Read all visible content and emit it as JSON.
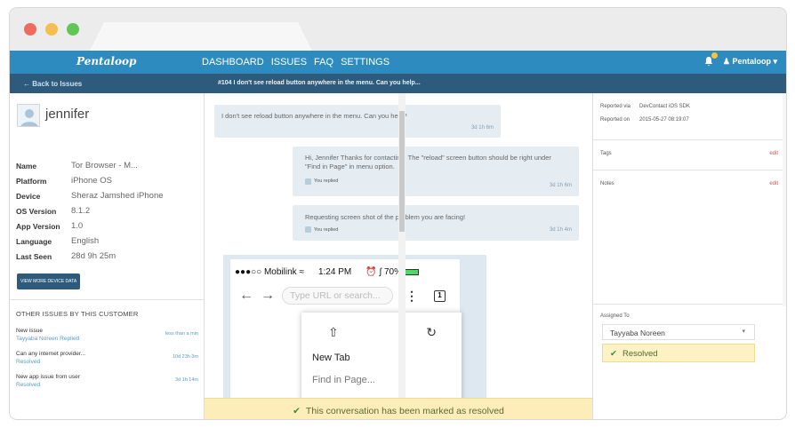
{
  "app": {
    "logo": "Pentaloop"
  },
  "nav": {
    "items": [
      "DASHBOARD",
      "ISSUES",
      "FAQ",
      "SETTINGS"
    ],
    "user": "Pentaloop"
  },
  "subbar": {
    "back": "← Back to Issues",
    "subject": "#104 I don't see reload button anywhere in the menu. Can you help..."
  },
  "customer": {
    "name": "jennifer",
    "fields": [
      {
        "k": "Name",
        "v": "Tor Browser - M..."
      },
      {
        "k": "Platform",
        "v": "iPhone OS"
      },
      {
        "k": "Device",
        "v": "Sheraz Jamshed iPhone"
      },
      {
        "k": "OS Version",
        "v": "8.1.2"
      },
      {
        "k": "App Version",
        "v": "1.0"
      },
      {
        "k": "Language",
        "v": "English"
      },
      {
        "k": "Last Seen",
        "v": "28d 9h 25m"
      }
    ],
    "device_button": "VIEW MORE DEVICE DATA"
  },
  "other_issues": {
    "title": "OTHER ISSUES BY THIS CUSTOMER",
    "items": [
      {
        "title": "New issue",
        "status": "Tayyaba Noreen Replied",
        "time": "less than a min"
      },
      {
        "title": "Can any internet provider...",
        "status": "Resolved",
        "time": "10d 23h 3m"
      },
      {
        "title": "New app issue from user",
        "status": "Resolved",
        "time": "3d 1h 14m"
      }
    ]
  },
  "messages": [
    {
      "text": "I don't see reload button anywhere in the menu. Can you help?",
      "time": "3d 1h 6m"
    },
    {
      "text": "Hi, Jennifer Thanks for contacting. The \"reload\" screen button should be right under \"Find in Page\" in menu option.",
      "by": "You replied",
      "time": "3d 1h 6m"
    },
    {
      "text": "Requesting screen shot of the problem you are facing!",
      "by": "You replied",
      "time": "3d 1h 4m"
    }
  ],
  "screenshot": {
    "carrier": "●●●○○ Mobilink",
    "time": "1:24 PM",
    "battery": "70%",
    "url_placeholder": "Type URL or search...",
    "tab_count": "1",
    "menu_items": [
      "New Tab",
      "Find in Page..."
    ]
  },
  "resolved_banner": "This conversation has been marked as resolved",
  "details": {
    "reported_via_label": "Reported via",
    "reported_via": "DevContact iOS SDK",
    "reported_on_label": "Reported on",
    "reported_on": "2015-05-27 08:19:07",
    "tags_label": "Tags",
    "notes_label": "Notes",
    "edit": "edit",
    "assigned_label": "Assigned To",
    "assignee": "Tayyaba Noreen",
    "status": "Resolved"
  }
}
